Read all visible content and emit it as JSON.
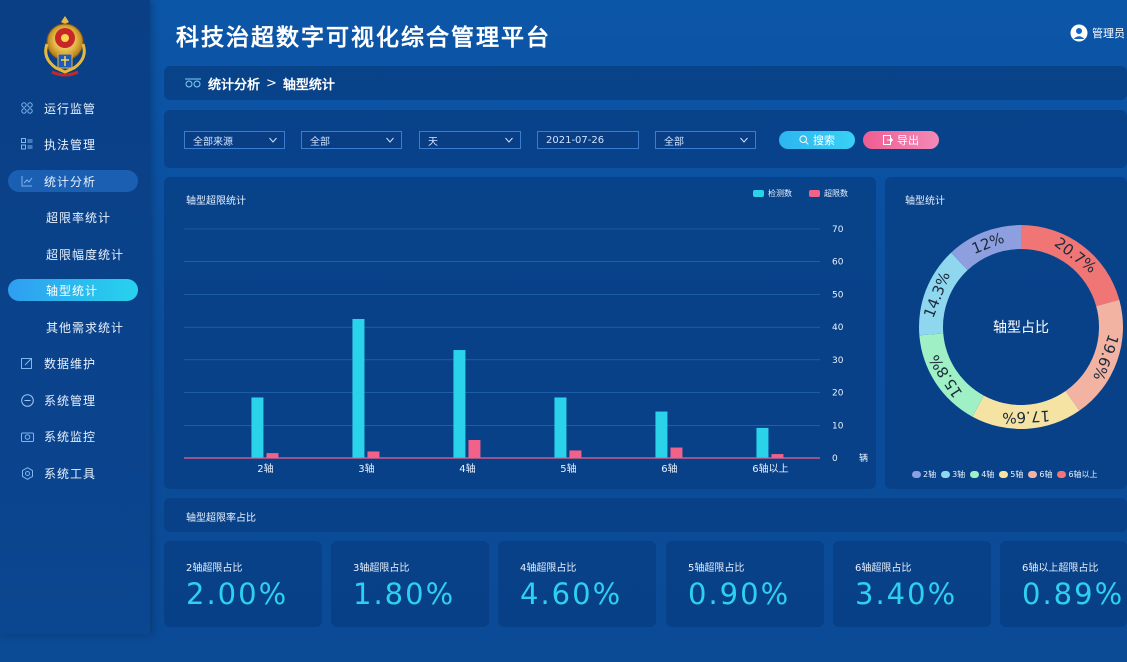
{
  "header": {
    "title": "科技治超数字可视化综合管理平台",
    "user": "管理员"
  },
  "sidebar": {
    "items": [
      {
        "label": "运行监管",
        "icon": "grid-icon"
      },
      {
        "label": "执法管理",
        "icon": "list-icon"
      },
      {
        "label": "统计分析",
        "icon": "chart-icon"
      },
      {
        "label": "超限率统计"
      },
      {
        "label": "超限幅度统计"
      },
      {
        "label": "轴型统计"
      },
      {
        "label": "其他需求统计"
      },
      {
        "label": "数据维护",
        "icon": "edit-icon"
      },
      {
        "label": "系统管理",
        "icon": "minus-circle-icon"
      },
      {
        "label": "系统监控",
        "icon": "camera-icon"
      },
      {
        "label": "系统工具",
        "icon": "gear-icon"
      }
    ]
  },
  "breadcrumb": {
    "parent": "统计分析",
    "separator": ">",
    "current": "轴型统计"
  },
  "filters": {
    "source": "全部来源",
    "scope": "全部",
    "period": "天",
    "date": "2021-07-26",
    "type": "全部",
    "search_label": "搜索",
    "export_label": "导出"
  },
  "bar_panel": {
    "title": "轴型超限统计"
  },
  "pie_panel": {
    "title": "轴型统计",
    "center_label": "轴型占比"
  },
  "rate_panel": {
    "title": "轴型超限率占比"
  },
  "colors": {
    "detect": "#2bd3ea",
    "over": "#f0628a",
    "accent_value": "#2ed0f0"
  },
  "chart_data": [
    {
      "type": "bar",
      "title": "轴型超限统计",
      "categories": [
        "2轴",
        "3轴",
        "4轴",
        "5轴",
        "6轴",
        "6轴以上"
      ],
      "series": [
        {
          "name": "检测数",
          "values": [
            18.5,
            42.5,
            33,
            18.5,
            14.2,
            9.2
          ]
        },
        {
          "name": "超限数",
          "values": [
            1.5,
            2,
            5.5,
            2.3,
            3.2,
            1.2
          ]
        }
      ],
      "ylim": [
        0,
        70
      ],
      "yticks": [
        0,
        10,
        20,
        30,
        40,
        50,
        60,
        70
      ],
      "yunit": "辆",
      "grid": true,
      "legend": "top-right"
    },
    {
      "type": "pie",
      "title": "轴型统计",
      "center_label": "轴型占比",
      "categories": [
        "2轴",
        "3轴",
        "4轴",
        "5轴",
        "6轴",
        "6轴以上"
      ],
      "labels": [
        "12%",
        "14.3%",
        "15.8%",
        "17.6%",
        "19.6%",
        "20.7%"
      ],
      "values": [
        12,
        14.3,
        15.8,
        17.6,
        19.6,
        20.7
      ],
      "colors": [
        "#8e9fe0",
        "#8fd6ef",
        "#9ff0c5",
        "#f4e3a3",
        "#f2b3a3",
        "#f07676"
      ],
      "legend": "bottom"
    }
  ],
  "rate_cards": [
    {
      "label": "2轴超限占比",
      "value": "2.00%"
    },
    {
      "label": "3轴超限占比",
      "value": "1.80%"
    },
    {
      "label": "4轴超限占比",
      "value": "4.60%"
    },
    {
      "label": "5轴超限占比",
      "value": "0.90%"
    },
    {
      "label": "6轴超限占比",
      "value": "3.40%"
    },
    {
      "label": "6轴以上超限占比",
      "value": "0.89%"
    }
  ]
}
